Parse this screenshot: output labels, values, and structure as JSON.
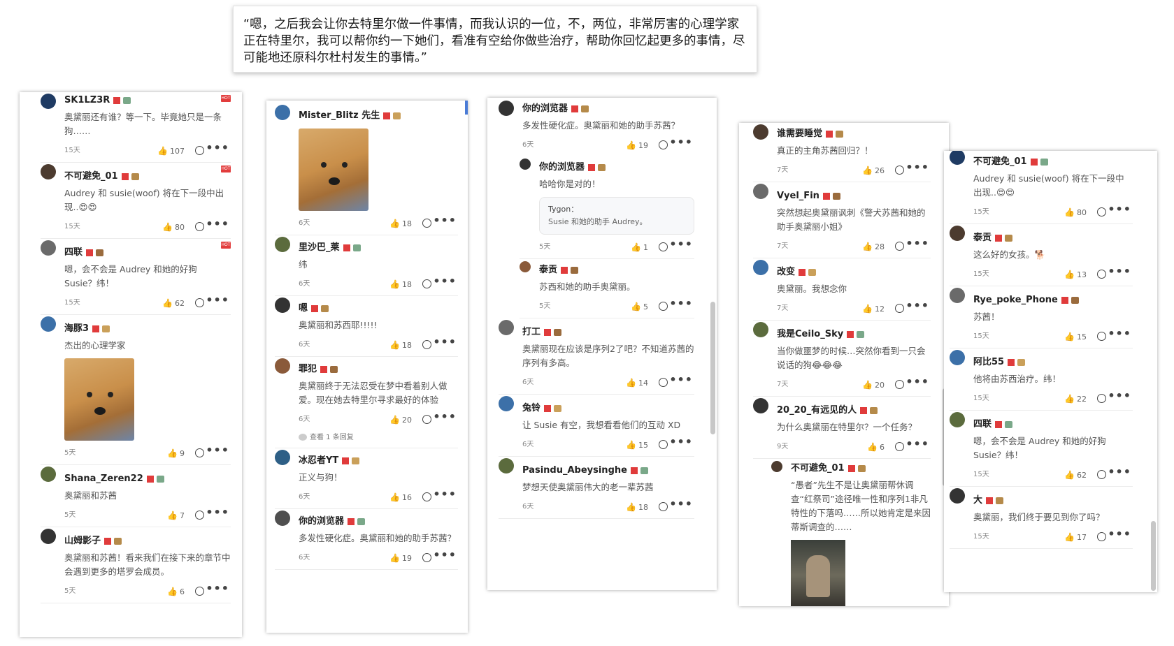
{
  "quote_text": "“嗯，之后我会让你去特里尔做一件事情，而我认识的一位，不，两位，非常厉害的心理学家正在特里尔，我可以帮你约一下她们，看准有空给你做些治疗，帮助你回忆起更多的事情，尽可能地还原科尔杜村发生的事情。”",
  "badge_hot": "HOT",
  "panel1": [
    {
      "name": "SK1LZ3R",
      "text": "奥黛丽还有谁？等一下。毕竟她只是一条狗……",
      "time": "15天",
      "likes": "107",
      "hot": true
    },
    {
      "name": "不可避免_01",
      "text": "Audrey 和 susie(woof) 将在下一段中出现..😍😍",
      "time": "15天",
      "likes": "80",
      "hot": true
    },
    {
      "name": "四联",
      "text": "嗯，会不会是 Audrey 和她的好狗 Susie？纬！",
      "time": "15天",
      "likes": "62",
      "hot": true
    },
    {
      "name": "海豚3",
      "text": "杰出的心理学家",
      "time": "5天",
      "likes": "9",
      "image": true
    },
    {
      "name": "Shana_Zeren22",
      "text": "奥黛丽和苏茜",
      "time": "5天",
      "likes": "7"
    },
    {
      "name": "山姆影子",
      "text": "奥黛丽和苏茜！看来我们在接下来的章节中会遇到更多的塔罗会成员。",
      "time": "5天",
      "likes": "6"
    }
  ],
  "panel2": [
    {
      "name": "Mister_Blitz 先生",
      "text": "",
      "time": "6天",
      "likes": "18",
      "image": true
    },
    {
      "name": "里沙巴_莱",
      "text": "纬",
      "time": "6天",
      "likes": "18"
    },
    {
      "name": "嗯",
      "text": "奥黛丽和苏西耶!!!!!",
      "time": "6天",
      "likes": "18"
    },
    {
      "name": "罪犯",
      "text": "奥黛丽终于无法忍受在梦中看着别人做爱。现在她去特里尔寻求最好的体验",
      "time": "6天",
      "likes": "20",
      "seemore": "查看 1 条回复"
    },
    {
      "name": "冰忍者YT",
      "text": "正义与狗！",
      "time": "6天",
      "likes": "16"
    },
    {
      "name": "你的浏览器",
      "text": "多发性硬化症。奥黛丽和她的助手苏茜？",
      "time": "6天",
      "likes": "19"
    }
  ],
  "panel3": {
    "main": {
      "name": "你的浏览器",
      "text": "多发性硬化症。奥黛丽和她的助手苏茜？",
      "time": "6天",
      "likes": "19"
    },
    "replies": [
      {
        "name": "你的浏览器",
        "text": "哈哈你是对的！",
        "quote_name": "Tygon：",
        "quote_text": "Susie 和她的助手 Audrey。",
        "time": "5天",
        "likes": "1"
      },
      {
        "name": "泰贡",
        "text": "苏西和她的助手奥黛丽。",
        "time": "5天",
        "likes": "5"
      }
    ],
    "rest": [
      {
        "name": "打工",
        "text": "奥黛丽现在应该是序列2了吧？不知道苏茜的序列有多高。",
        "time": "6天",
        "likes": "14"
      },
      {
        "name": "兔铃",
        "text": "让 Susie 有空，我想看看他们的互动 XD",
        "time": "6天",
        "likes": "15"
      },
      {
        "name": "Pasindu_Abeysinghe",
        "text": "梦想天使奥黛丽伟大的老一辈苏茜",
        "time": "6天",
        "likes": "18"
      }
    ]
  },
  "panel4": [
    {
      "name": "谁需要睡觉",
      "text": "真正的主角苏茜回归？！",
      "time": "7天",
      "likes": "26"
    },
    {
      "name": "Vyel_Fin",
      "text": "突然想起奥黛丽讽刺《警犬苏茜和她的助手奥黛丽小姐》",
      "time": "7天",
      "likes": "28"
    },
    {
      "name": "改变",
      "text": "奥黛丽。我想念你",
      "time": "7天",
      "likes": "12"
    },
    {
      "name": "我是Ceilo_Sky",
      "text": "当你做噩梦的时候…突然你看到一只会说话的狗😂😂😂",
      "time": "7天",
      "likes": "20"
    },
    {
      "name": "20_20_有远见的人",
      "text": "为什么奥黛丽在特里尔？一个任务？",
      "time": "9天",
      "likes": "6"
    }
  ],
  "panel4_reply": {
    "name": "不可避免_01",
    "text": "“愚者”先生不是让奥黛丽帮休调查“红祭司”途径唯一性和序列1非凡特性的下落吗……所以她肯定是来因蒂斯调查的……"
  },
  "panel5": [
    {
      "name": "不可避免_01",
      "text": "Audrey 和 susie(woof) 将在下一段中出现..😍😍",
      "time": "15天",
      "likes": "80"
    },
    {
      "name": "泰贡",
      "text": "这么好的女孩。🐕",
      "time": "15天",
      "likes": "13"
    },
    {
      "name": "Rye_poke_Phone",
      "text": "苏茜！",
      "time": "15天",
      "likes": "15"
    },
    {
      "name": "阿比55",
      "text": "他将由苏西治疗。纬！",
      "time": "15天",
      "likes": "22"
    },
    {
      "name": "四联",
      "text": "嗯，会不会是 Audrey 和她的好狗 Susie？纬！",
      "time": "15天",
      "likes": "62"
    },
    {
      "name": "大",
      "text": "奥黛丽，我们终于要见到你了吗？",
      "time": "15天",
      "likes": "17"
    }
  ]
}
